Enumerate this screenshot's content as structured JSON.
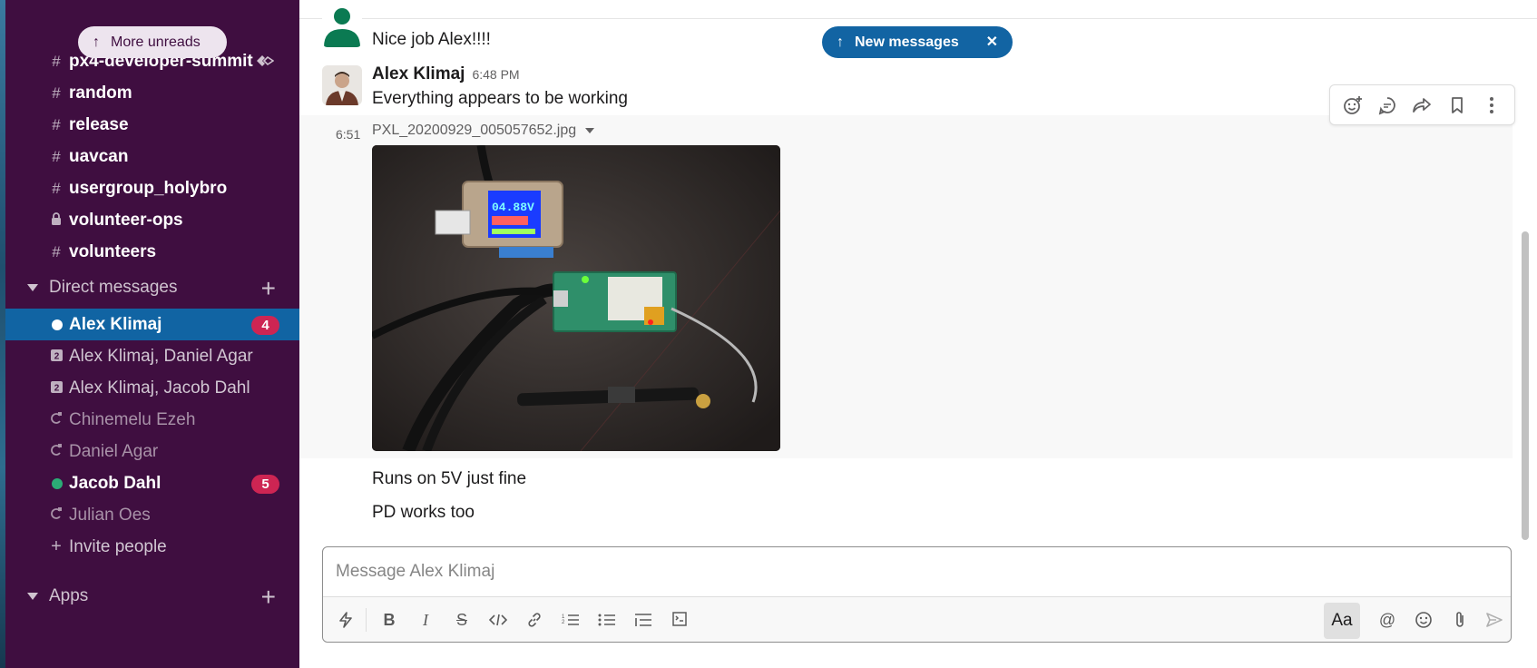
{
  "sidebar": {
    "more_unreads": "More unreads",
    "channels": [
      {
        "name": "px4-developer-summit"
      },
      {
        "name": "random"
      },
      {
        "name": "release"
      },
      {
        "name": "uavcan"
      },
      {
        "name": "usergroup_holybro"
      },
      {
        "name": "volunteer-ops",
        "private": true
      },
      {
        "name": "volunteers"
      }
    ],
    "channel_prefix": "#",
    "direct_messages_label": "Direct messages",
    "dms": [
      {
        "name": "Alex Klimaj",
        "badge": "4"
      },
      {
        "name": "Alex Klimaj, Daniel Agar",
        "count_icon": "2"
      },
      {
        "name": "Alex Klimaj, Jacob Dahl",
        "count_icon": "2"
      },
      {
        "name": "Chinemelu Ezeh"
      },
      {
        "name": "Daniel Agar"
      },
      {
        "name": "Jacob Dahl",
        "badge": "5"
      },
      {
        "name": "Julian Oes"
      }
    ],
    "invite_label": "Invite people",
    "apps_label": "Apps",
    "colors": {
      "background": "#3f0e40",
      "active": "#1164a3",
      "badge": "#cd2553"
    }
  },
  "messages": {
    "first": {
      "text": "Nice job Alex!!!!"
    },
    "second": {
      "author": "Alex Klimaj",
      "time": "6:48 PM",
      "text": "Everything appears to be working"
    },
    "file": {
      "time": "6:51",
      "filename": "PXL_20200929_005057652.jpg",
      "screen_reading": "04.88V"
    },
    "third": {
      "text": "Runs on 5V just fine"
    },
    "fourth": {
      "text": "PD works too"
    }
  },
  "new_messages_pill": {
    "label": "New messages",
    "color": "#1264a3"
  },
  "composer": {
    "placeholder": "Message Alex Klimaj",
    "format_label": "Aa"
  },
  "icons": {
    "message_actions": [
      "add-reaction-icon",
      "reply-thread-icon",
      "share-icon",
      "bookmark-icon",
      "more-actions-icon"
    ],
    "toolbar": [
      "shortcuts-icon",
      "bold-icon",
      "italic-icon",
      "strikethrough-icon",
      "code-icon",
      "link-icon",
      "ordered-list-icon",
      "bulleted-list-icon",
      "blockquote-icon",
      "code-block-icon",
      "mention-icon",
      "emoji-icon",
      "attach-icon",
      "send-icon"
    ]
  }
}
